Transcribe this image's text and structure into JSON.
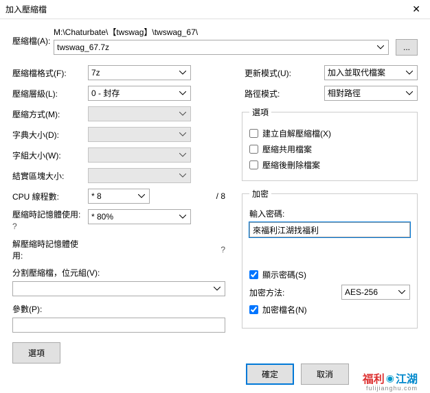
{
  "title": "加入壓縮檔",
  "archive": {
    "label": "壓縮檔(A):",
    "path": "M:\\Chaturbate\\【twswag】\\twswag_67\\",
    "filename": "twswag_67.7z",
    "browse": "..."
  },
  "left": {
    "format": {
      "label": "壓縮檔格式(F):",
      "value": "7z"
    },
    "level": {
      "label": "壓縮層級(L):",
      "value": "0 - 封存"
    },
    "method": {
      "label": "壓縮方式(M):"
    },
    "dict": {
      "label": "字典大小(D):"
    },
    "word": {
      "label": "字組大小(W):"
    },
    "solid": {
      "label": "結實區塊大小:"
    },
    "threads": {
      "label": "CPU 線程數:",
      "value": "* 8",
      "total": "/ 8"
    },
    "memcomp": {
      "label": "壓縮時記憶體使用:",
      "hint": "?",
      "value": "* 80%"
    },
    "memdecomp": {
      "label": "解壓縮時記憶體使用:",
      "hint": "?"
    },
    "split": {
      "label": "分割壓縮檔，位元組(V):"
    },
    "params": {
      "label": "參數(P):"
    },
    "options_btn": "選項"
  },
  "right": {
    "update": {
      "label": "更新模式(U):",
      "value": "加入並取代檔案"
    },
    "pathmode": {
      "label": "路徑模式:",
      "value": "相對路徑"
    },
    "options": {
      "legend": "選項",
      "sfx": "建立自解壓縮檔(X)",
      "shared": "壓縮共用檔案",
      "delafter": "壓縮後刪除檔案"
    },
    "enc": {
      "legend": "加密",
      "pwlabel": "輸入密碼:",
      "pwvalue": "來福利江湖找福利",
      "showpw": "顯示密碼(S)",
      "method_label": "加密方法:",
      "method_value": "AES-256",
      "encnames": "加密檔名(N)"
    }
  },
  "footer": {
    "ok": "確定",
    "cancel": "取消"
  },
  "watermark": {
    "text1": "福利",
    "text2": "江湖",
    "sub": "fulijianghu.com"
  }
}
